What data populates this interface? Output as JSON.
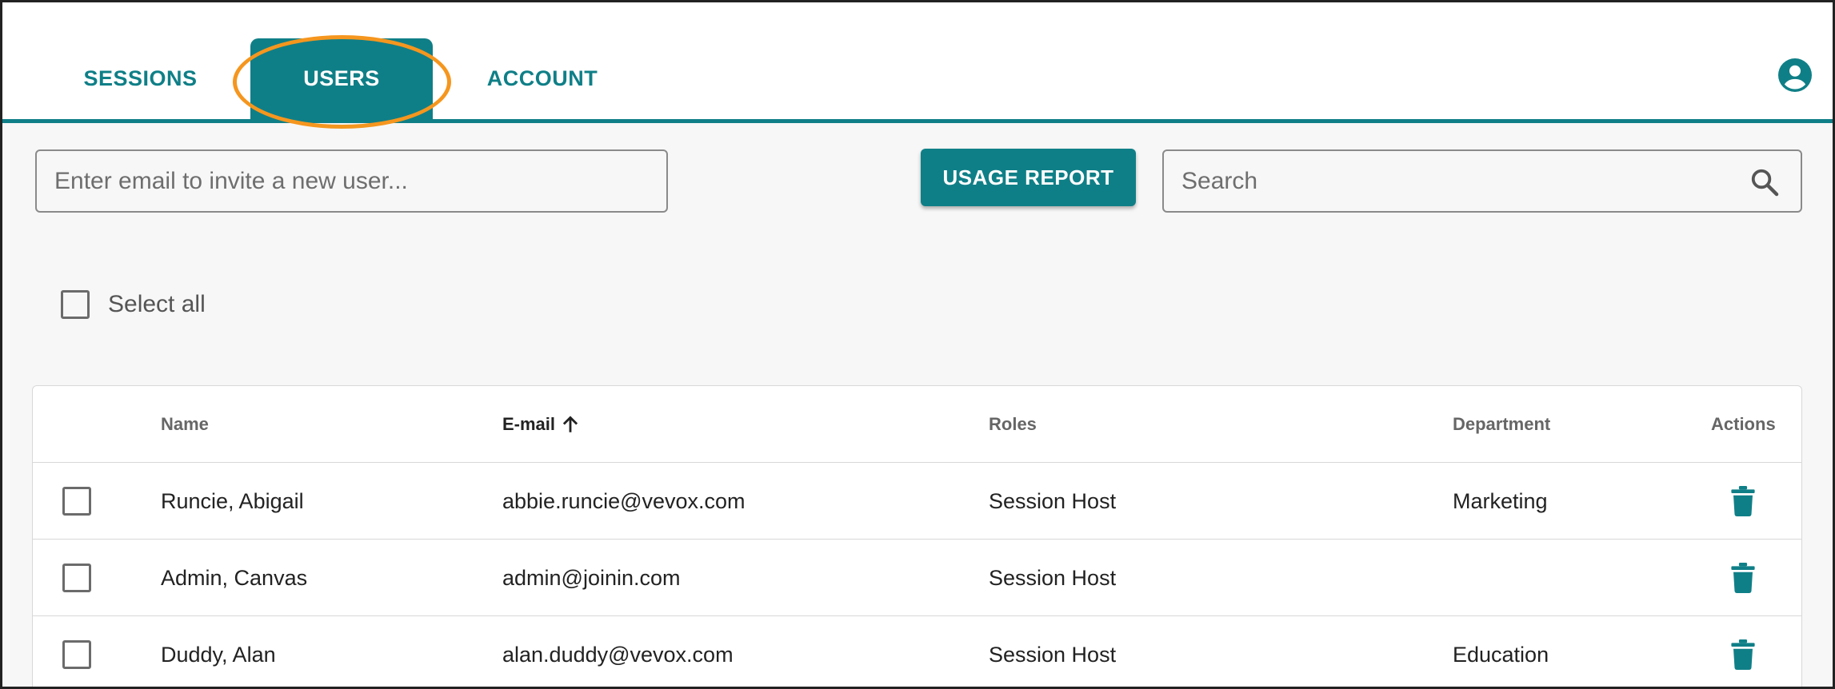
{
  "nav": {
    "tabs": [
      {
        "label": "SESSIONS",
        "active": false
      },
      {
        "label": "USERS",
        "active": true
      },
      {
        "label": "ACCOUNT",
        "active": false
      }
    ],
    "profile_icon": "account-circle-icon"
  },
  "toolbar": {
    "invite_placeholder": "Enter email to invite a new user...",
    "usage_report_label": "USAGE REPORT",
    "search_placeholder": "Search"
  },
  "select_all_label": "Select all",
  "table": {
    "columns": {
      "name": "Name",
      "email": "E-mail",
      "roles": "Roles",
      "department": "Department",
      "actions": "Actions"
    },
    "sort": {
      "column": "email",
      "direction": "ascending"
    },
    "rows": [
      {
        "name": "Runcie, Abigail",
        "email": "abbie.runcie@vevox.com",
        "roles": "Session Host",
        "department": "Marketing"
      },
      {
        "name": "Admin, Canvas",
        "email": "admin@joinin.com",
        "roles": "Session Host",
        "department": ""
      },
      {
        "name": "Duddy, Alan",
        "email": "alan.duddy@vevox.com",
        "roles": "Session Host",
        "department": "Education"
      }
    ]
  },
  "colors": {
    "accent": "#0f7f87",
    "highlight": "#f5961e",
    "background": "#f7f7f7"
  }
}
